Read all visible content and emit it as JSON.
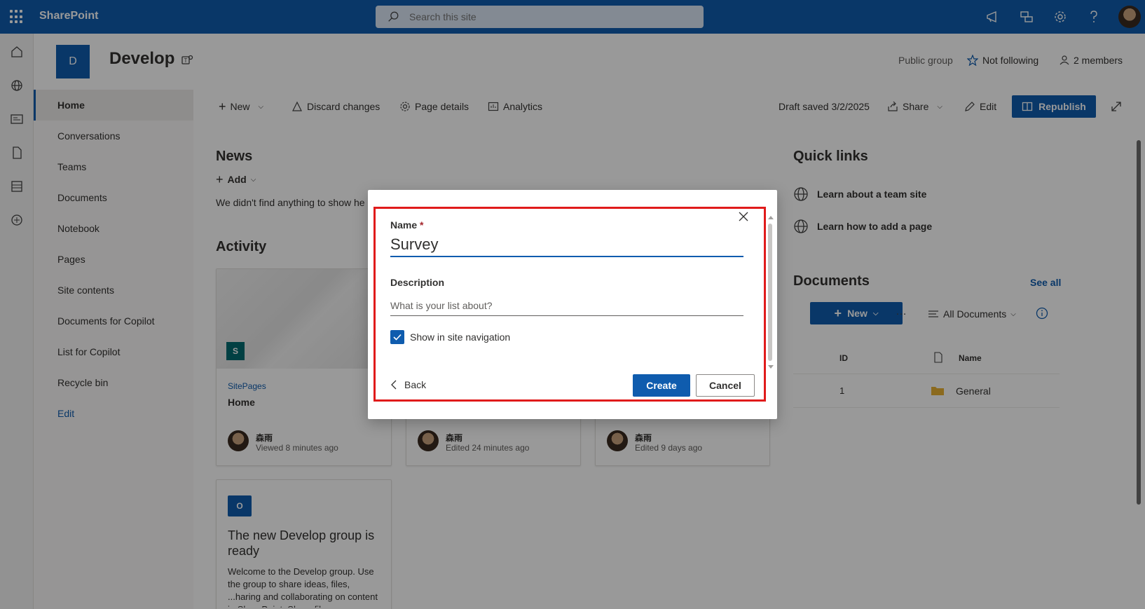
{
  "suite": {
    "app_name": "SharePoint",
    "search_placeholder": "Search this site"
  },
  "site": {
    "logo_letter": "D",
    "title": "Develop",
    "privacy": "Public group",
    "follow": "Not following",
    "members": "2 members"
  },
  "nav": {
    "items": [
      "Home",
      "Conversations",
      "Teams",
      "Documents",
      "Notebook",
      "Pages",
      "Site contents",
      "Documents for Copilot",
      "List for Copilot",
      "Recycle bin"
    ],
    "edit": "Edit"
  },
  "commandbar": {
    "new": "New",
    "discard": "Discard changes",
    "page_details": "Page details",
    "analytics": "Analytics",
    "draft_saved": "Draft saved 3/2/2025",
    "share": "Share",
    "edit": "Edit",
    "republish": "Republish"
  },
  "news": {
    "title": "News",
    "add": "Add",
    "empty": "We didn't find anything to show he"
  },
  "activity": {
    "title": "Activity",
    "cards": [
      {
        "library": "SitePages",
        "title": "Home",
        "user": "森雨",
        "when": "Viewed 8 minutes ago"
      },
      {
        "user": "森雨",
        "when": "Edited 24 minutes ago"
      },
      {
        "user": "森雨",
        "when": "Edited 9 days ago"
      }
    ],
    "group_card": {
      "title": "The new Develop group is ready",
      "body": "Welcome to the Develop group. Use the group to share ideas, files, ...haring and collaborating on content in SharePoint. Share files"
    }
  },
  "quicklinks": {
    "title": "Quick links",
    "items": [
      "Learn about a team site",
      "Learn how to add a page"
    ]
  },
  "documents": {
    "title": "Documents",
    "see_all": "See all",
    "new": "New",
    "more": "…",
    "view": "All Documents",
    "columns": [
      "ID",
      "Name"
    ],
    "rows": [
      {
        "id": "1",
        "name": "General"
      }
    ]
  },
  "dialog": {
    "name_label": "Name",
    "required_mark": "*",
    "name_value": "Survey",
    "description_label": "Description",
    "description_placeholder": "What is your list about?",
    "show_in_nav_label": "Show in site navigation",
    "show_in_nav_checked": true,
    "back": "Back",
    "create": "Create",
    "cancel": "Cancel"
  },
  "colors": {
    "brand": "#0f5cae",
    "highlight": "#e01b1b"
  }
}
